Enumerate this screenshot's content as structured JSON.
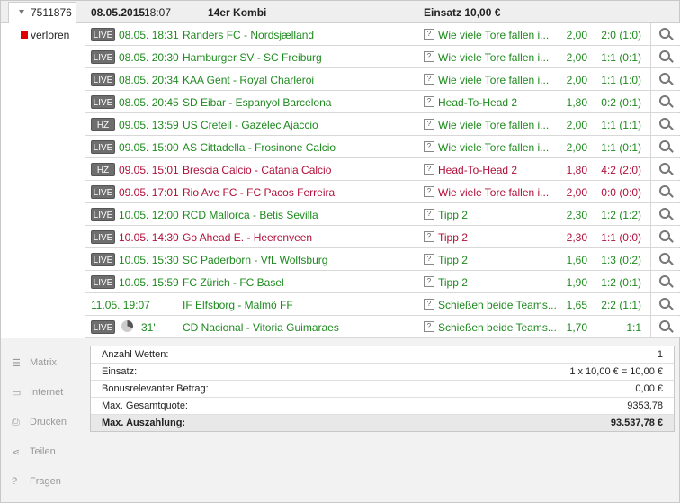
{
  "header": {
    "ticket_id": "7511876",
    "date": "08.05.2015",
    "time": "18:07",
    "bet_type": "14er Kombi",
    "stake": "Einsatz 10,00 €"
  },
  "status": {
    "label": "verloren",
    "color": "#e00000"
  },
  "colors": {
    "win": "#1e8a1e",
    "loss": "#b0103a"
  },
  "bets": [
    {
      "badge": "LIVE",
      "datetime": "08.05. 18:31",
      "match": "Randers FC - Nordsjælland",
      "market": "Wie viele Tore fallen i...",
      "odds": "2,00",
      "result": "2:0 (1:0)",
      "outcome": "win"
    },
    {
      "badge": "LIVE",
      "datetime": "08.05. 20:30",
      "match": "Hamburger SV - SC Freiburg",
      "market": "Wie viele Tore fallen i...",
      "odds": "2,00",
      "result": "1:1 (0:1)",
      "outcome": "win"
    },
    {
      "badge": "LIVE",
      "datetime": "08.05. 20:34",
      "match": "KAA Gent - Royal Charleroi",
      "market": "Wie viele Tore fallen i...",
      "odds": "2,00",
      "result": "1:1 (1:0)",
      "outcome": "win"
    },
    {
      "badge": "LIVE",
      "datetime": "08.05. 20:45",
      "match": "SD Eibar - Espanyol Barcelona",
      "market": "Head-To-Head 2",
      "odds": "1,80",
      "result": "0:2 (0:1)",
      "outcome": "win"
    },
    {
      "badge": "HZ",
      "datetime": "09.05. 13:59",
      "match": "US Creteil - Gazélec Ajaccio",
      "market": "Wie viele Tore fallen i...",
      "odds": "2,00",
      "result": "1:1 (1:1)",
      "outcome": "win"
    },
    {
      "badge": "LIVE",
      "datetime": "09.05. 15:00",
      "match": "AS Cittadella - Frosinone Calcio",
      "market": "Wie viele Tore fallen i...",
      "odds": "2,00",
      "result": "1:1 (0:1)",
      "outcome": "win"
    },
    {
      "badge": "HZ",
      "datetime": "09.05. 15:01",
      "match": "Brescia Calcio - Catania Calcio",
      "market": "Head-To-Head 2",
      "odds": "1,80",
      "result": "4:2 (2:0)",
      "outcome": "loss"
    },
    {
      "badge": "LIVE",
      "datetime": "09.05. 17:01",
      "match": "Rio Ave FC - FC Pacos Ferreira",
      "market": "Wie viele Tore fallen i...",
      "odds": "2,00",
      "result": "0:0 (0:0)",
      "outcome": "loss"
    },
    {
      "badge": "LIVE",
      "datetime": "10.05. 12:00",
      "match": "RCD Mallorca - Betis Sevilla",
      "market": "Tipp 2",
      "odds": "2,30",
      "result": "1:2 (1:2)",
      "outcome": "win"
    },
    {
      "badge": "LIVE",
      "datetime": "10.05. 14:30",
      "match": "Go Ahead E. - Heerenveen",
      "market": "Tipp 2",
      "odds": "2,30",
      "result": "1:1 (0:0)",
      "outcome": "loss"
    },
    {
      "badge": "LIVE",
      "datetime": "10.05. 15:30",
      "match": "SC Paderborn - VfL Wolfsburg",
      "market": "Tipp 2",
      "odds": "1,60",
      "result": "1:3 (0:2)",
      "outcome": "win"
    },
    {
      "badge": "LIVE",
      "datetime": "10.05. 15:59",
      "match": "FC Zürich - FC Basel",
      "market": "Tipp 2",
      "odds": "1,90",
      "result": "1:2 (0:1)",
      "outcome": "win"
    },
    {
      "badge": "",
      "datetime": "11.05. 19:07",
      "match": "IF Elfsborg - Malmö FF",
      "market": "Schießen beide Teams...",
      "odds": "1,65",
      "result": "2:2 (1:1)",
      "outcome": "win"
    },
    {
      "badge": "LIVE",
      "datetime": "31'",
      "match": "CD Nacional - Vitoria Guimaraes",
      "market": "Schießen beide Teams...",
      "odds": "1,70",
      "result": "1:1",
      "outcome": "win",
      "live_clock": true
    }
  ],
  "side_menu": [
    {
      "label": "Matrix",
      "icon": "list-icon"
    },
    {
      "label": "Internet",
      "icon": "monitor-icon"
    },
    {
      "label": "Drucken",
      "icon": "printer-icon"
    },
    {
      "label": "Teilen",
      "icon": "share-icon"
    },
    {
      "label": "Fragen",
      "icon": "help-icon"
    }
  ],
  "summary": [
    {
      "key": "Anzahl Wetten:",
      "value": "1"
    },
    {
      "key": "Einsatz:",
      "value": "1 x 10,00 € = 10,00 €"
    },
    {
      "key": "Bonusrelevanter Betrag:",
      "value": "0,00 €"
    },
    {
      "key": "Max. Gesamtquote:",
      "value": "9353,78"
    },
    {
      "key": "Max. Auszahlung:",
      "value": "93.537,78 €",
      "total": true
    }
  ]
}
